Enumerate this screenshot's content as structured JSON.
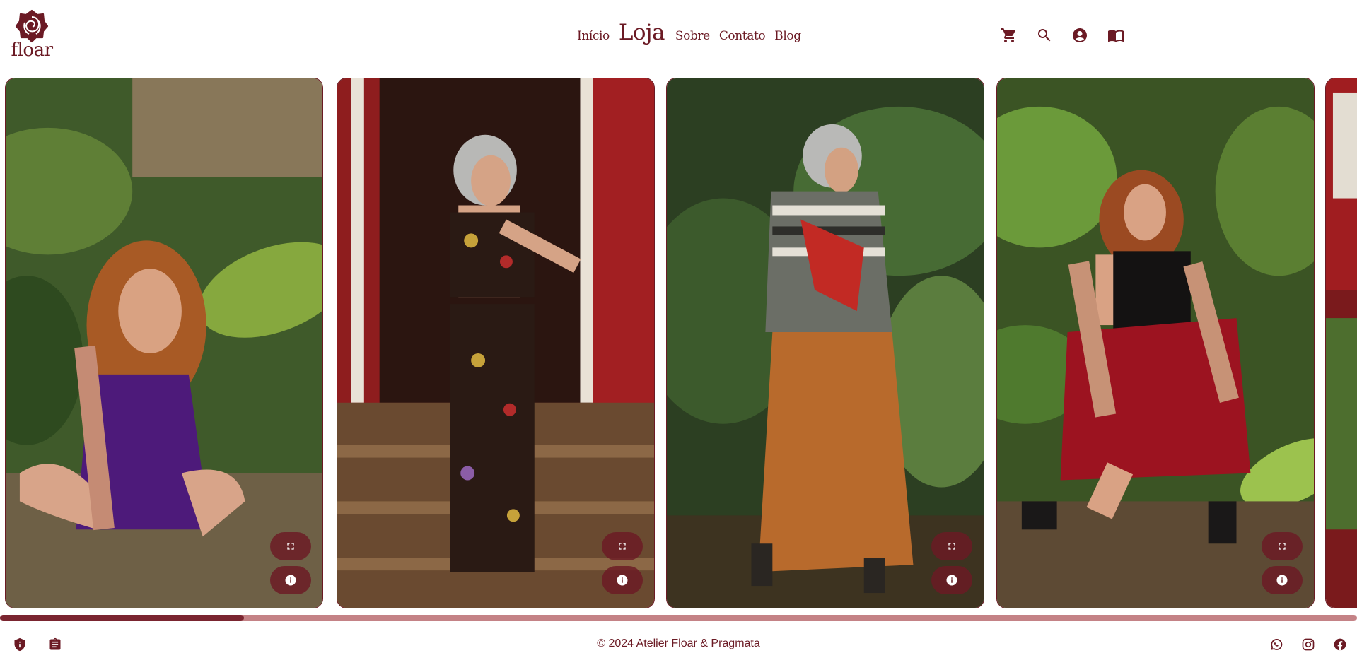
{
  "brand": {
    "logo_text": "floar",
    "color": "#6b1a24",
    "scroll_track_color": "#c48286"
  },
  "nav": {
    "items": [
      {
        "label": "Início",
        "active": false
      },
      {
        "label": "Loja",
        "active": true
      },
      {
        "label": "Sobre",
        "active": false
      },
      {
        "label": "Contato",
        "active": false
      },
      {
        "label": "Blog",
        "active": false
      }
    ]
  },
  "header_icons": [
    "cart-icon",
    "search-icon",
    "account-icon",
    "catalog-icon"
  ],
  "gallery": {
    "cards": [
      {
        "subject": "woman-purple-dress",
        "expand_icon": "fullscreen-icon",
        "info_icon": "info-icon"
      },
      {
        "subject": "woman-floral-set",
        "expand_icon": "fullscreen-icon",
        "info_icon": "info-icon"
      },
      {
        "subject": "woman-striped-top-orange-skirt",
        "expand_icon": "fullscreen-icon",
        "info_icon": "info-icon"
      },
      {
        "subject": "woman-red-skirt-black-top",
        "expand_icon": "fullscreen-icon",
        "info_icon": "info-icon"
      }
    ],
    "scroll_progress": 0.18
  },
  "footer": {
    "left_icons": [
      "privacy-shield-icon",
      "terms-clipboard-icon"
    ],
    "copyright": "© 2024 Atelier Floar & Pragmata",
    "social_icons": [
      "whatsapp-icon",
      "instagram-icon",
      "facebook-icon"
    ]
  }
}
